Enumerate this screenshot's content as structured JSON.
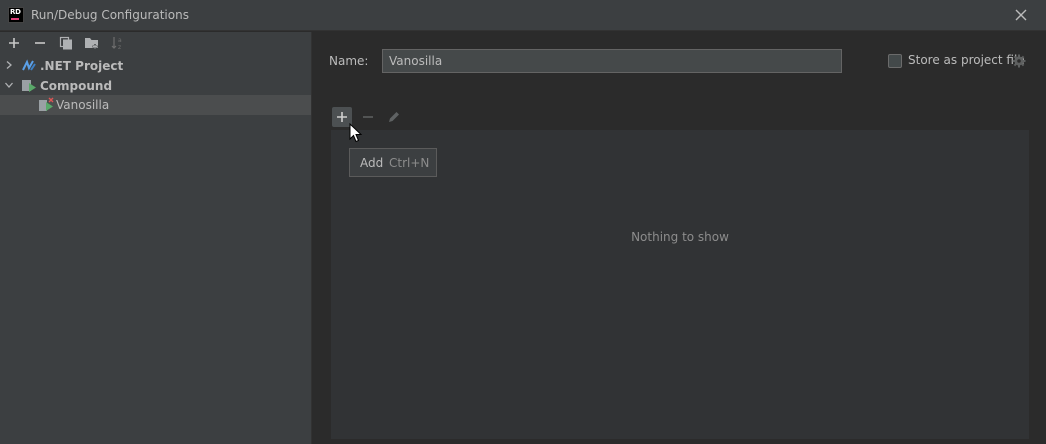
{
  "window": {
    "title": "Run/Debug Configurations",
    "logo_text": "RD"
  },
  "left_toolbar": {
    "icons": [
      "add-icon",
      "remove-icon",
      "copy-icon",
      "folder-icon",
      "sort-icon"
    ]
  },
  "tree": [
    {
      "label": ".NET Project",
      "expanded": false,
      "icon": "dotnet-icon"
    },
    {
      "label": "Compound",
      "expanded": true,
      "icon": "compound-icon"
    },
    {
      "label": "Vanosilla",
      "selected": true,
      "icon": "compound-config-icon"
    }
  ],
  "form": {
    "name_label": "Name:",
    "name_value": "Vanosilla",
    "store_label": "Store as project file",
    "store_checked": false
  },
  "list": {
    "empty_text": "Nothing to show",
    "toolbar_icons": [
      "add-icon",
      "remove-icon",
      "edit-icon"
    ]
  },
  "tooltip": {
    "label": "Add",
    "shortcut": "Ctrl+N"
  }
}
